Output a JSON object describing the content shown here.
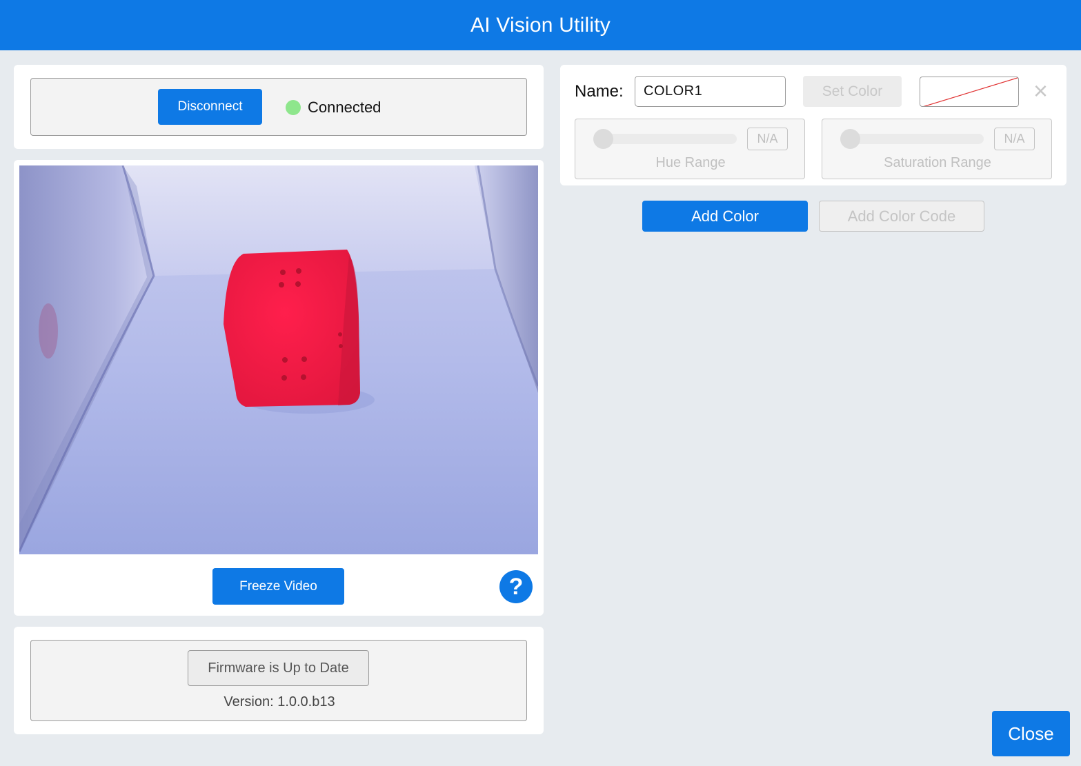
{
  "window": {
    "title": "AI Vision Utility"
  },
  "connection": {
    "disconnect_label": "Disconnect",
    "status_text": "Connected",
    "status_color": "#8ee68c"
  },
  "video": {
    "freeze_label": "Freeze Video",
    "help_label": "?"
  },
  "firmware": {
    "status_label": "Firmware is Up to Date",
    "version_text": "Version: 1.0.0.b13"
  },
  "color_editor": {
    "name_label": "Name:",
    "name_value": "COLOR1",
    "set_color_label": "Set Color",
    "close_icon": "×",
    "hue": {
      "value_text": "N/A",
      "label": "Hue Range"
    },
    "saturation": {
      "value_text": "N/A",
      "label": "Saturation Range"
    }
  },
  "actions": {
    "add_color_label": "Add Color",
    "add_color_code_label": "Add Color Code",
    "close_label": "Close"
  },
  "theme": {
    "accent": "#0e79e5",
    "background": "#e7ebef"
  }
}
